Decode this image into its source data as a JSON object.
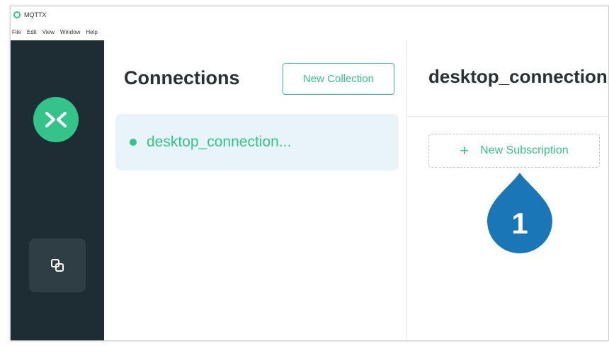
{
  "window": {
    "title": "MQTTX"
  },
  "menu": [
    "File",
    "Edit",
    "View",
    "Window",
    "Help"
  ],
  "connections_panel": {
    "title": "Connections",
    "new_collection_label": "New Collection",
    "items": [
      {
        "name": "desktop_connection...",
        "status": "connected"
      }
    ]
  },
  "detail_panel": {
    "title": "desktop_connection",
    "new_subscription_label": "New Subscription",
    "new_subscription_icon": "plus-icon"
  },
  "callout": {
    "number": "1"
  },
  "colors": {
    "accent": "#34c388",
    "sidebar": "#1e2d34",
    "sidebar_button": "#2f3e45",
    "selected_row": "#e9f4fa",
    "callout": "#1b76b8"
  },
  "icons": {
    "app_logo": "mqttx-logo-icon",
    "sidebar_button": "connections-icon"
  }
}
